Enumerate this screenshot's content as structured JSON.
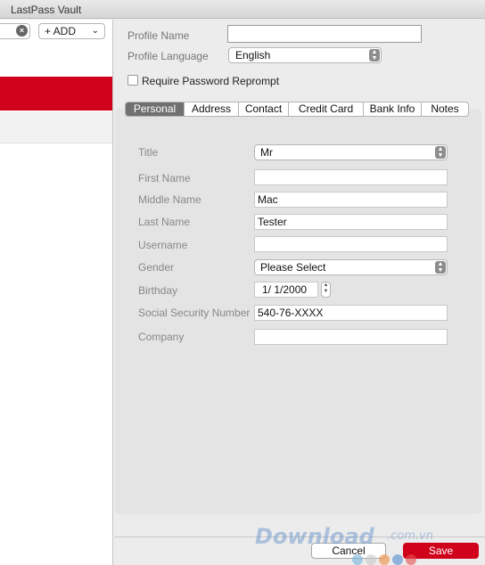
{
  "window": {
    "title": "LastPass Vault"
  },
  "sidebar": {
    "clear_icon": "x-circle-icon",
    "add_label": "+ ADD",
    "add_chevron": "⌄"
  },
  "profile": {
    "name_label": "Profile Name",
    "name_value": "",
    "language_label": "Profile Language",
    "language_value": "English",
    "reprompt_label": "Require Password Reprompt",
    "reprompt_checked": false
  },
  "tabs": [
    {
      "label": "Personal",
      "active": true
    },
    {
      "label": "Address",
      "active": false
    },
    {
      "label": "Contact",
      "active": false
    },
    {
      "label": "Credit Card",
      "active": false
    },
    {
      "label": "Bank Info",
      "active": false
    },
    {
      "label": "Notes",
      "active": false
    }
  ],
  "fields": {
    "title_label": "Title",
    "title_value": "Mr",
    "first_name_label": "First Name",
    "first_name_value": "",
    "middle_name_label": "Middle Name",
    "middle_name_value": "Mac",
    "last_name_label": "Last Name",
    "last_name_value": "Tester",
    "username_label": "Username",
    "username_value": "",
    "gender_label": "Gender",
    "gender_value": "Please Select",
    "birthday_label": "Birthday",
    "birthday_value": "1/  1/2000",
    "ssn_label": "Social Security Number",
    "ssn_value": "540-76-XXXX",
    "company_label": "Company",
    "company_value": ""
  },
  "footer": {
    "cancel_label": "Cancel",
    "save_label": "Save"
  },
  "watermark": {
    "text": "Download",
    "suffix": ".com.vn"
  },
  "colors": {
    "accent": "#d0021b",
    "tab_active": "#707070"
  }
}
